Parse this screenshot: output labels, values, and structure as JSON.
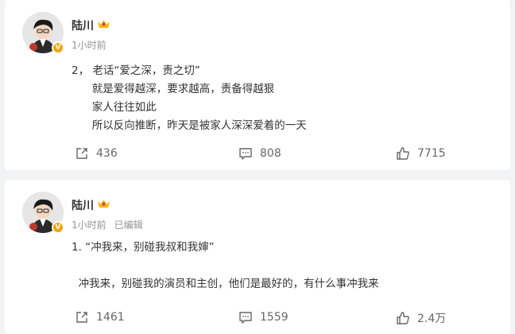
{
  "posts": [
    {
      "author": "陆川",
      "time": "1小时前",
      "edited": "",
      "lines": [
        "2， 老话“爱之深，责之切”",
        "      就是爱得越深，要求越高，责备得越狠",
        "      家人往往如此",
        "      所以反向推断，昨天是被家人深深爱着的一天"
      ],
      "shares": "436",
      "comments": "808",
      "likes": "7715"
    },
    {
      "author": "陆川",
      "time": "1小时前",
      "edited": "已编辑",
      "lines": [
        "1. “冲我来，别碰我叔和我婶”",
        "",
        "  冲我来，别碰我的演员和主创，他们是最好的，有什么事冲我来"
      ],
      "shares": "1461",
      "comments": "1559",
      "likes": "2.4万"
    }
  ],
  "icons": {
    "share": "share-icon",
    "comment": "comment-icon",
    "like": "like-icon",
    "verified": "verified-v-icon",
    "crown": "crown-icon"
  },
  "colors": {
    "background": "#f2f3f5",
    "card": "#ffffff",
    "meta": "#939393",
    "badge": "#f5a300"
  }
}
